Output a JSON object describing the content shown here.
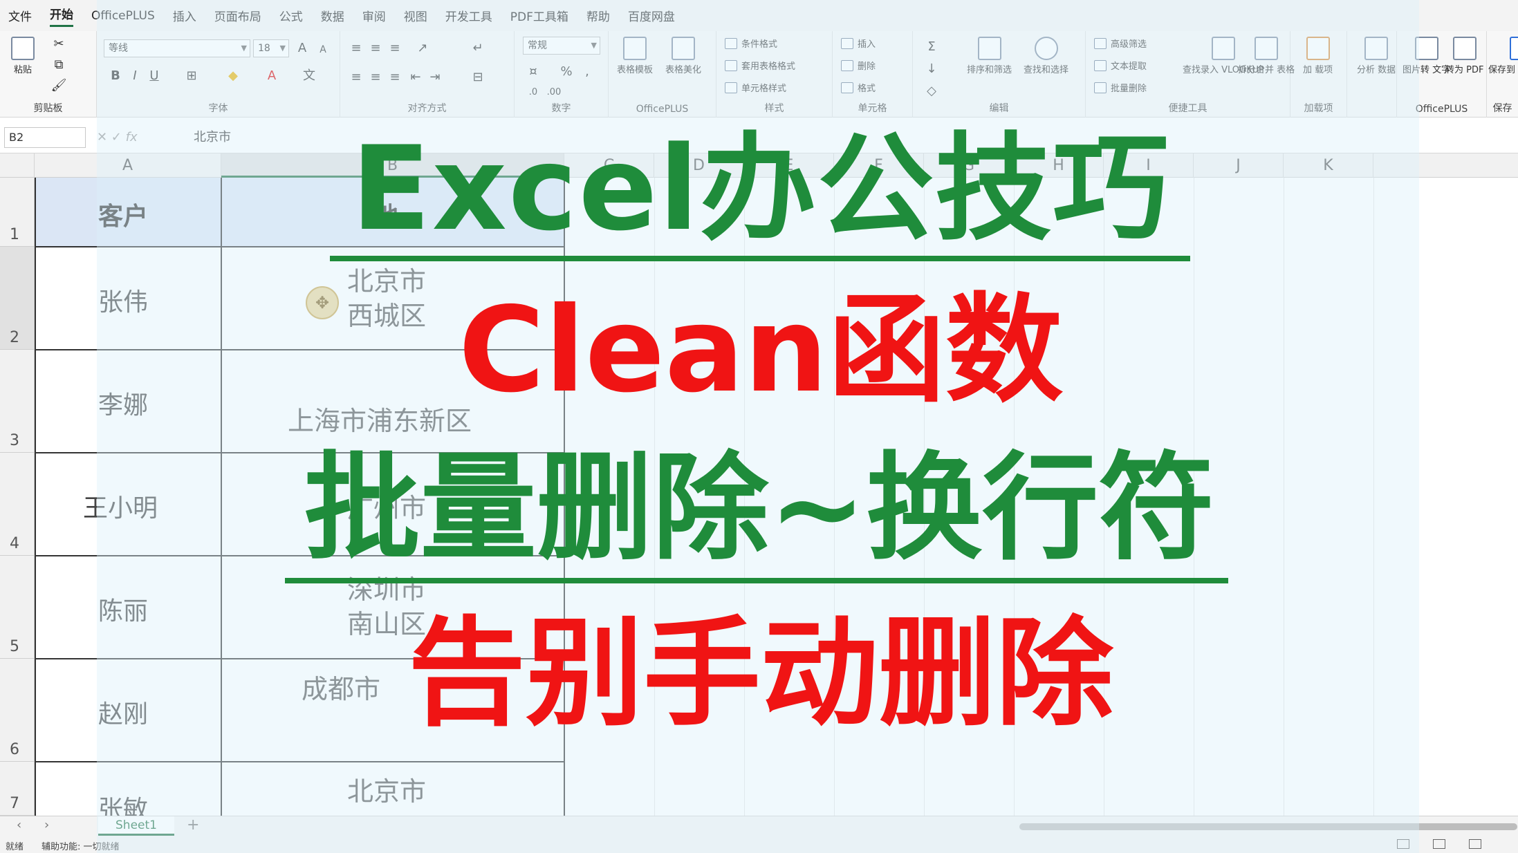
{
  "menu": [
    "文件",
    "开始",
    "OfficePLUS",
    "插入",
    "页面布局",
    "公式",
    "数据",
    "审阅",
    "视图",
    "开发工具",
    "PDF工具箱",
    "帮助",
    "百度网盘"
  ],
  "menu_active_index": 1,
  "ribbon": {
    "clipboard": {
      "paste": "粘贴",
      "label": "剪贴板"
    },
    "font": {
      "name": "等线",
      "size": "18",
      "label": "字体"
    },
    "alignment": {
      "label": "对齐方式"
    },
    "number": {
      "format": "常规",
      "label": "数字"
    },
    "officeplus": {
      "template": "表格模板",
      "beautify": "表格美化",
      "label": "OfficePLUS"
    },
    "styles": {
      "cond": "条件格式",
      "table": "套用表格格式",
      "cell": "单元格样式",
      "label": "样式"
    },
    "cells": {
      "insert": "插入",
      "delete": "删除",
      "format": "格式",
      "label": "单元格"
    },
    "editing": {
      "sort": "排序和筛选",
      "find": "查找和选择",
      "label": "编辑"
    },
    "tools": {
      "adv_filter": "高级筛选",
      "text_extract": "文本提取",
      "batch_delete": "批量删除",
      "lookup": "查找录入 VLOOKUP",
      "split_merge": "拆分合并 表格",
      "label": "便捷工具"
    },
    "addins": {
      "addin": "加 载项",
      "label": "加载项"
    },
    "analysis": {
      "analyze": "分析 数据"
    },
    "officeplus2": {
      "img2text": "图片转 文字",
      "topdf": "转为 PDF",
      "label": "OfficePLUS"
    },
    "save": {
      "baidu": "保存到 百度网盘",
      "label": "保存"
    }
  },
  "formula_bar": {
    "name_box": "B2",
    "value": "北京市"
  },
  "columns": [
    "A",
    "B",
    "C",
    "D",
    "E",
    "F",
    "G",
    "H",
    "I",
    "J",
    "K"
  ],
  "rows": [
    "1",
    "2",
    "3",
    "4",
    "5",
    "6",
    "7"
  ],
  "table": {
    "header_a": "客户",
    "header_b": "地",
    "customers": [
      "张伟",
      "李娜",
      "王小明",
      "陈丽",
      "赵刚",
      "张敏"
    ],
    "address_lines": [
      [
        "北京市",
        "西城区"
      ],
      [
        "上海市浦东新区"
      ],
      [
        "广州市"
      ],
      [
        "深圳市",
        "南山区"
      ],
      [
        "成都市"
      ],
      [
        "北京市"
      ]
    ]
  },
  "sheet": {
    "tab": "Sheet1",
    "add": "+"
  },
  "status": {
    "ready": "就绪",
    "accessibility": "辅助功能: 一切就绪"
  },
  "overlay": {
    "line1": "Excel办公技巧",
    "line2": "Clean函数",
    "line3": "批量删除~换行符",
    "line4": "告别手动删除"
  },
  "colors": {
    "green": "#1f8c3b",
    "red": "#f01414",
    "excel_green": "#217346"
  }
}
